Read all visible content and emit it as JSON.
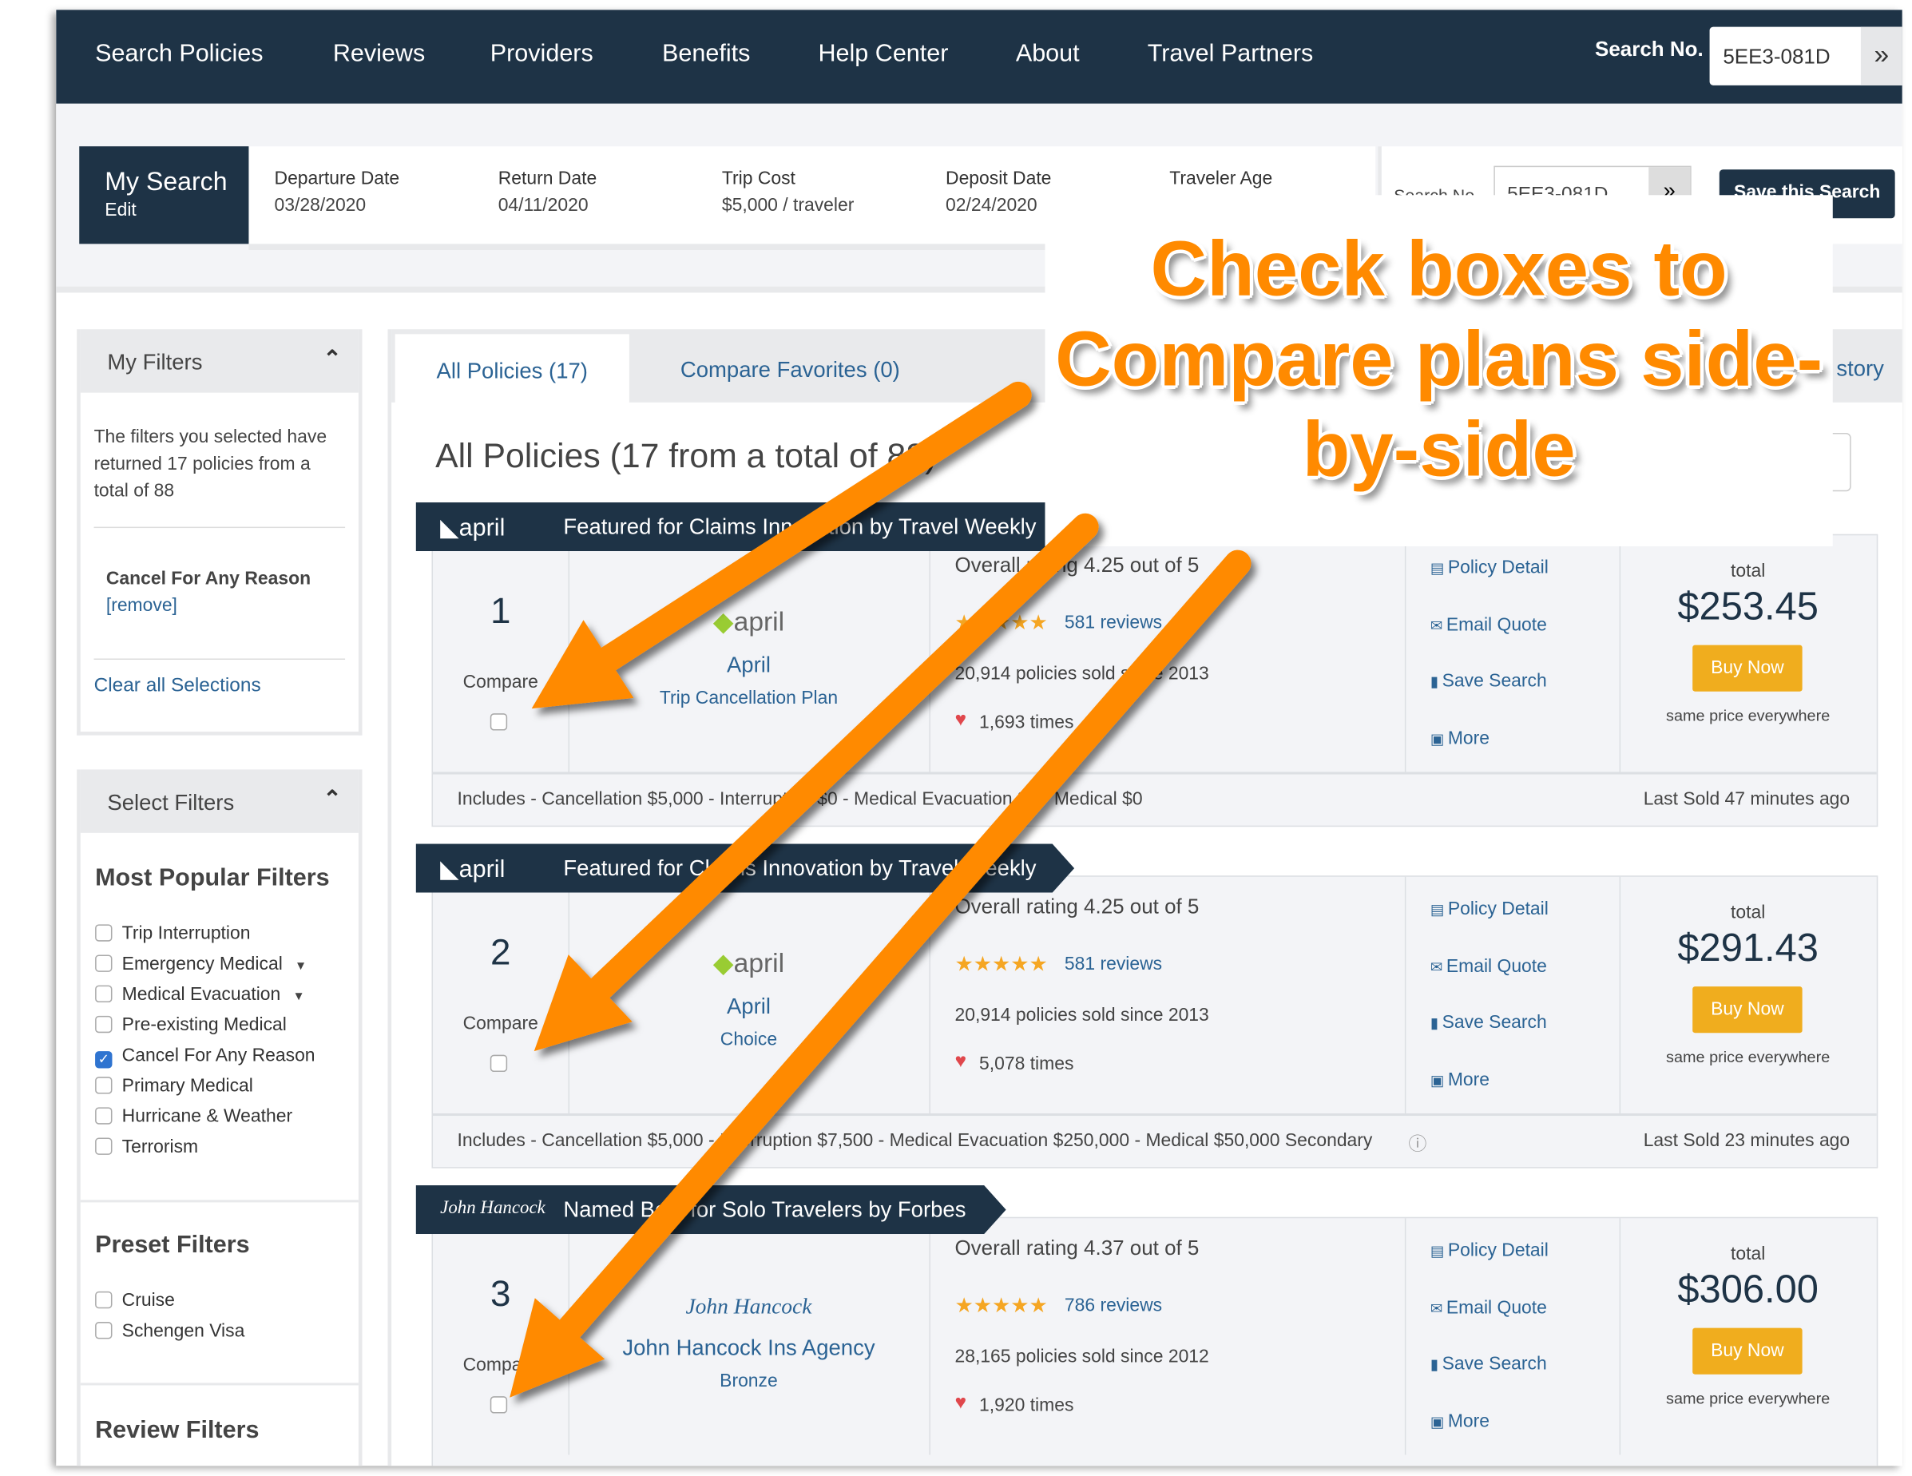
{
  "nav": {
    "items": [
      "Search Policies",
      "Reviews",
      "Providers",
      "Benefits",
      "Help Center",
      "About",
      "Travel Partners"
    ],
    "search_no_label": "Search No.",
    "search_no_value": "5EE3-081D",
    "go_icon": "double-chevron-right-icon"
  },
  "my_search": {
    "title": "My Search",
    "edit": "Edit",
    "fields": [
      {
        "label": "Departure Date",
        "value": "03/28/2020"
      },
      {
        "label": "Return Date",
        "value": "04/11/2020"
      },
      {
        "label": "Trip Cost",
        "value": "$5,000 / traveler"
      },
      {
        "label": "Deposit Date",
        "value": "02/24/2020"
      },
      {
        "label": "Traveler Age",
        "value": ""
      }
    ],
    "search_no_label": "Search No",
    "search_no_value": "5EE3-081D",
    "save_label": "Save this Search"
  },
  "my_filters": {
    "title": "My Filters",
    "summary": "The filters you selected have returned 17 policies from a total of 88",
    "active": "Cancel For Any Reason",
    "remove": "[remove]",
    "clear": "Clear all Selections"
  },
  "select_filters": {
    "title": "Select Filters",
    "popular_title": "Most Popular Filters",
    "popular": [
      {
        "label": "Trip Interruption",
        "checked": false
      },
      {
        "label": "Emergency Medical",
        "checked": false,
        "dropdown": true
      },
      {
        "label": "Medical Evacuation",
        "checked": false,
        "dropdown": true
      },
      {
        "label": "Pre-existing Medical",
        "checked": false
      },
      {
        "label": "Cancel For Any Reason",
        "checked": true
      },
      {
        "label": "Primary Medical",
        "checked": false
      },
      {
        "label": "Hurricane & Weather",
        "checked": false
      },
      {
        "label": "Terrorism",
        "checked": false
      }
    ],
    "preset_title": "Preset Filters",
    "preset": [
      {
        "label": "Cruise",
        "checked": false
      },
      {
        "label": "Schengen Visa",
        "checked": false
      }
    ],
    "review_title": "Review Filters"
  },
  "tabs": [
    {
      "label": "All Policies (17)",
      "active": true
    },
    {
      "label": "Compare Favorites (0)",
      "active": false
    },
    {
      "label": "story",
      "active": false
    }
  ],
  "results_heading": "All Policies (17 from a total of 88)",
  "annotation": {
    "lines": [
      "Check boxes to",
      "Compare plans side-",
      "by-side"
    ],
    "color": "#ff8a00"
  },
  "policies": [
    {
      "rank": "1",
      "compare_label": "Compare",
      "ribbon_logo": "april",
      "ribbon": "Featured for Claims Innovation by Travel Weekly",
      "provider_logo": "april",
      "provider": "April",
      "plan": "Trip Cancellation Plan",
      "rating": "Overall rating 4.25 out of 5",
      "stars": 4.25,
      "reviews": "581 reviews",
      "sold": "20,914 policies sold since 2013",
      "favorites": "1,693 times",
      "links": [
        "Policy Detail",
        "Email Quote",
        "Save Search",
        "More"
      ],
      "total_label": "total",
      "price": "$253.45",
      "buy": "Buy Now",
      "price_note": "same price everywhere",
      "includes": "Includes - Cancellation $5,000 - Interruption $0 - Medical Evacuation $0 - Medical $0",
      "last_sold": "Last Sold 47 minutes ago"
    },
    {
      "rank": "2",
      "compare_label": "Compare",
      "ribbon_logo": "april",
      "ribbon": "Featured for Claims Innovation by Travel Weekly",
      "provider_logo": "april",
      "provider": "April",
      "plan": "Choice",
      "rating": "Overall rating 4.25 out of 5",
      "stars": 4.25,
      "reviews": "581 reviews",
      "sold": "20,914 policies sold since 2013",
      "favorites": "5,078 times",
      "links": [
        "Policy Detail",
        "Email Quote",
        "Save Search",
        "More"
      ],
      "total_label": "total",
      "price": "$291.43",
      "buy": "Buy Now",
      "price_note": "same price everywhere",
      "includes": "Includes - Cancellation $5,000 - Interruption $7,500 - Medical Evacuation $250,000 - Medical $50,000 Secondary",
      "last_sold": "Last Sold 23 minutes ago"
    },
    {
      "rank": "3",
      "compare_label": "Compare",
      "ribbon_logo": "John Hancock",
      "ribbon": "Named Best for Solo Travelers by Forbes",
      "provider_logo": "John Hancock",
      "provider": "John Hancock Ins Agency",
      "plan": "Bronze",
      "rating": "Overall rating 4.37 out of 5",
      "stars": 4.37,
      "reviews": "786 reviews",
      "sold": "28,165 policies sold since 2012",
      "favorites": "1,920 times",
      "links": [
        "Policy Detail",
        "Email Quote",
        "Save Search",
        "More"
      ],
      "total_label": "total",
      "price": "$306.00",
      "buy": "Buy Now",
      "price_note": "same price everywhere"
    }
  ],
  "colors": {
    "nav": "#1e3346",
    "link": "#2b6394",
    "buy": "#f0ad1e",
    "star": "#f5a623",
    "heart": "#e0474c",
    "arrow": "#ff8a00"
  }
}
